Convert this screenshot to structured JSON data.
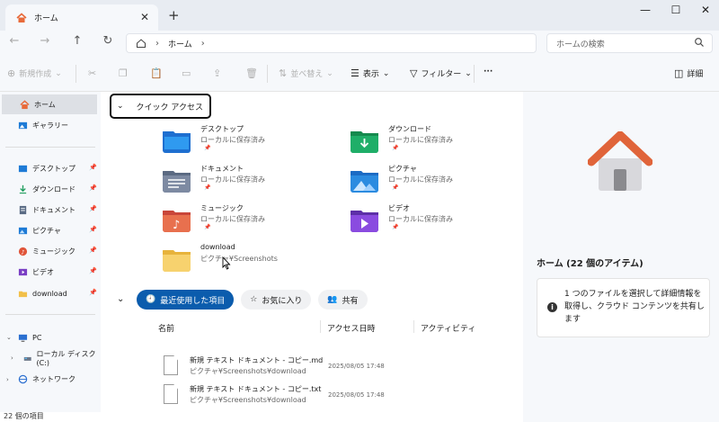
{
  "tab": {
    "title": "ホーム",
    "close": "✕",
    "add": "+"
  },
  "window": {
    "minimize": "—",
    "maximize": "☐",
    "close": "✕"
  },
  "address": {
    "back": "←",
    "forward": "→",
    "up": "↑",
    "refresh": "↻",
    "crumb": "ホーム",
    "sep": "›",
    "search_placeholder": "ホームの検索"
  },
  "toolbar": {
    "new_label": "新規作成",
    "sort_label": "並べ替え",
    "view_label": "表示",
    "filter_label": "フィルター",
    "more_label": "···",
    "details_label": "詳細"
  },
  "sidebar": {
    "home": "ホーム",
    "gallery": "ギャラリー",
    "pinned": [
      {
        "label": "デスクトップ",
        "icon": "desktop-icon",
        "color": "#1e7bd6"
      },
      {
        "label": "ダウンロード",
        "icon": "download-icon",
        "color": "#1a9b5a"
      },
      {
        "label": "ドキュメント",
        "icon": "document-icon",
        "color": "#5a6b85"
      },
      {
        "label": "ピクチャ",
        "icon": "pictures-icon",
        "color": "#1e7bd6"
      },
      {
        "label": "ミュージック",
        "icon": "music-icon",
        "color": "#e0553a"
      },
      {
        "label": "ビデオ",
        "icon": "video-icon",
        "color": "#7a3fc4"
      },
      {
        "label": "download",
        "icon": "folder-icon",
        "color": "#f2c04a"
      }
    ],
    "pc": "PC",
    "local_disk": "ローカル ディスク (C:)",
    "network": "ネットワーク"
  },
  "status": {
    "count": "22 個の項目"
  },
  "quick_access": {
    "header": "クイック アクセス",
    "folders": [
      {
        "name": "デスクトップ",
        "sub": "ローカルに保存済み",
        "color": "#1e6fd0"
      },
      {
        "name": "ダウンロード",
        "sub": "ローカルに保存済み",
        "color": "#1a9b5a"
      },
      {
        "name": "ドキュメント",
        "sub": "ローカルに保存済み",
        "color": "#6a7890"
      },
      {
        "name": "ピクチャ",
        "sub": "ローカルに保存済み",
        "color": "#2b8be0"
      },
      {
        "name": "ミュージック",
        "sub": "ローカルに保存済み",
        "color": "#e06040"
      },
      {
        "name": "ビデオ",
        "sub": "ローカルに保存済み",
        "color": "#7a3fc4"
      },
      {
        "name": "download",
        "sub": "ピクチャ¥Screenshots",
        "color": "#f6cf6a"
      }
    ],
    "pin_glyph": "📌"
  },
  "recent": {
    "tab_recent": "最近使用した項目",
    "tab_fav": "お気に入り",
    "tab_shared": "共有",
    "col_name": "名前",
    "col_date": "アクセス日時",
    "col_activity": "アクティビティ",
    "files": [
      {
        "name": "新規 テキスト ドキュメント - コピー.md",
        "path": "ピクチャ¥Screenshots¥download",
        "date": "2025/08/05 17:48"
      },
      {
        "name": "新規 テキスト ドキュメント - コピー.txt",
        "path": "ピクチャ¥Screenshots¥download",
        "date": "2025/08/05 17:48"
      }
    ]
  },
  "details": {
    "title": "ホーム (22 個のアイテム)",
    "message": "1 つのファイルを選択して詳細情報を取得し、クラウド コンテンツを共有します"
  }
}
